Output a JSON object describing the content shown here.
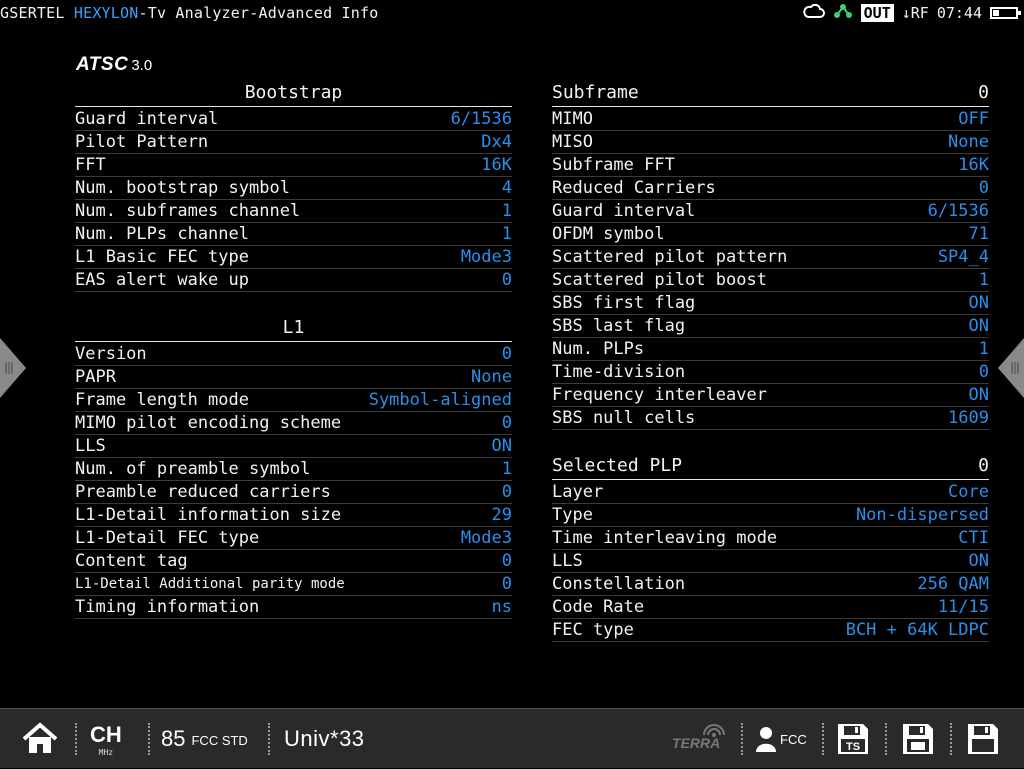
{
  "header": {
    "brand_prefix": "GSERTEL",
    "brand_name": "HEXYLON",
    "title": "-Tv Analyzer-Advanced Info",
    "out_label": "OUT",
    "rf_label": "↓RF",
    "time": "07:44",
    "battery_level": 0.25
  },
  "logo": {
    "text": "ATSC",
    "version": "3.0"
  },
  "bootstrap": {
    "heading": "Bootstrap",
    "rows": [
      {
        "label": "Guard interval",
        "value": "6/1536"
      },
      {
        "label": "Pilot Pattern",
        "value": "Dx4"
      },
      {
        "label": "FFT",
        "value": "16K"
      },
      {
        "label": "Num. bootstrap symbol",
        "value": "4"
      },
      {
        "label": "Num. subframes channel",
        "value": "1"
      },
      {
        "label": "Num. PLPs channel",
        "value": "1"
      },
      {
        "label": "L1 Basic FEC type",
        "value": "Mode3"
      },
      {
        "label": "EAS alert wake up",
        "value": "0"
      }
    ]
  },
  "l1": {
    "heading": "L1",
    "rows": [
      {
        "label": "Version",
        "value": "0"
      },
      {
        "label": "PAPR",
        "value": "None"
      },
      {
        "label": "Frame length mode",
        "value": "Symbol-aligned"
      },
      {
        "label": "MIMO pilot encoding scheme",
        "value": "0"
      },
      {
        "label": "LLS",
        "value": "ON"
      },
      {
        "label": "Num. of preamble symbol",
        "value": "1"
      },
      {
        "label": "Preamble reduced carriers",
        "value": "0"
      },
      {
        "label": "L1-Detail information size",
        "value": "29"
      },
      {
        "label": "L1-Detail FEC type",
        "value": "Mode3"
      },
      {
        "label": "Content tag",
        "value": "0"
      },
      {
        "label": "L1-Detail Additional parity mode",
        "value": "0"
      },
      {
        "label": "Timing information",
        "value": "ns"
      }
    ]
  },
  "subframe": {
    "heading": "Subframe",
    "heading_value": "0",
    "rows": [
      {
        "label": "MIMO",
        "value": "OFF"
      },
      {
        "label": "MISO",
        "value": "None"
      },
      {
        "label": "Subframe FFT",
        "value": "16K"
      },
      {
        "label": "Reduced Carriers",
        "value": "0"
      },
      {
        "label": "Guard interval",
        "value": "6/1536"
      },
      {
        "label": "OFDM symbol",
        "value": "71"
      },
      {
        "label": "Scattered pilot pattern",
        "value": "SP4_4"
      },
      {
        "label": "Scattered pilot boost",
        "value": "1"
      },
      {
        "label": "SBS first flag",
        "value": "ON"
      },
      {
        "label": "SBS last flag",
        "value": "ON"
      },
      {
        "label": "Num. PLPs",
        "value": "1"
      },
      {
        "label": "Time-division",
        "value": "0"
      },
      {
        "label": "Frequency interleaver",
        "value": "ON"
      },
      {
        "label": "SBS null cells",
        "value": "1609"
      }
    ]
  },
  "selected_plp": {
    "heading": "Selected PLP",
    "heading_value": "0",
    "rows": [
      {
        "label": "Layer",
        "value": "Core"
      },
      {
        "label": "Type",
        "value": "Non-dispersed"
      },
      {
        "label": "Time interleaving mode",
        "value": "CTI"
      },
      {
        "label": "LLS",
        "value": "ON"
      },
      {
        "label": "Constellation",
        "value": "256 QAM"
      },
      {
        "label": "Code Rate",
        "value": "11/15"
      },
      {
        "label": "FEC type",
        "value": "BCH + 64K LDPC"
      }
    ]
  },
  "bottombar": {
    "ch_label": "CH",
    "ch_unit": "MHz",
    "channel": "85",
    "channel_std": "FCC STD",
    "univ": "Univ*33",
    "terra": "TERRA",
    "region": "FCC",
    "save_ts_label": "TS"
  },
  "colors": {
    "value": "#2b8fea",
    "brand": "#3aa0ff",
    "bar_bg": "#2a2a2a"
  }
}
